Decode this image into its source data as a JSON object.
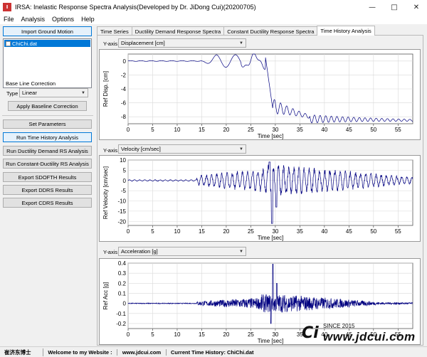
{
  "window": {
    "title": "IRSA: Inelastic Response Spectra Analysis(Developed by Dr. JiDong Cui)(20200705)",
    "app_icon_glyph": "I",
    "minimize_icon": "minimize-icon",
    "maximize_icon": "maximize-icon",
    "close_icon": "close-icon"
  },
  "menu": [
    "File",
    "Analysis",
    "Options",
    "Help"
  ],
  "left": {
    "import_label": "Import Ground Motion",
    "file_item": "ChiChi.dat",
    "baseline_label": "Base Line Correction",
    "type_label": "Type",
    "type_value": "Linear",
    "apply_label": "Apply Baseline Correction",
    "set_params": "Set Parameters",
    "run_th": "Run Time History Analysis",
    "run_dd": "Run Ductility Demand RS Analysis",
    "run_cd": "Run Constant-Ductility RS Analysis",
    "export_sdofth": "Export SDOFTH Results",
    "export_ddrs": "Export DDRS Results",
    "export_cdrs": "Export CDRS Results"
  },
  "tabs": [
    "Time Series",
    "Ductility Demand Response Spectra",
    "Constant Ductility Response Spectra",
    "Time History Analysis"
  ],
  "active_tab": 3,
  "yaxis_label": "Y-axis",
  "plots": [
    {
      "select_value": "Displacement [cm]",
      "ylabel": "Ref Disp. [cm]",
      "xlabel": "Time [sec]",
      "ylim": [
        -9,
        1
      ],
      "yticks": [
        0,
        -2,
        -4,
        -6,
        -8
      ],
      "xlim": [
        0,
        58
      ],
      "xticks": [
        0,
        5,
        10,
        15,
        20,
        25,
        30,
        35,
        40,
        45,
        50,
        55
      ]
    },
    {
      "select_value": "Velocity [cm/sec]",
      "ylabel": "Ref Velocity [cm/sec]",
      "xlabel": "Time [sec]",
      "ylim": [
        -22,
        10
      ],
      "yticks": [
        10,
        5,
        0,
        -5,
        -10,
        -15,
        -20
      ],
      "xlim": [
        0,
        58
      ],
      "xticks": [
        0,
        5,
        10,
        15,
        20,
        25,
        30,
        35,
        40,
        45,
        50,
        55
      ]
    },
    {
      "select_value": "Acceleration [g]",
      "ylabel": "Ref Acc [g]",
      "xlabel": "Time [sec]",
      "ylim": [
        -0.25,
        0.4
      ],
      "yticks": [
        0.4,
        0.3,
        0.2,
        0.1,
        0,
        -0.1,
        -0.2
      ],
      "xlim": [
        0,
        58
      ],
      "xticks": [
        0,
        5,
        10,
        15,
        20,
        25,
        30,
        35,
        40,
        45,
        50,
        55
      ]
    }
  ],
  "colors": {
    "line": "#000080",
    "grid": "#d9d9d9",
    "select_blue": "#0078d7"
  },
  "status": {
    "author": "崔济东博士",
    "welcome": "Welcome to my Website :",
    "site": "www.jdcui.com",
    "current": "Current Time History: ChiChi.dat"
  },
  "watermark": {
    "logo": "Ci",
    "since": "SINCE 2015",
    "url": "www.jdcui.com"
  }
}
